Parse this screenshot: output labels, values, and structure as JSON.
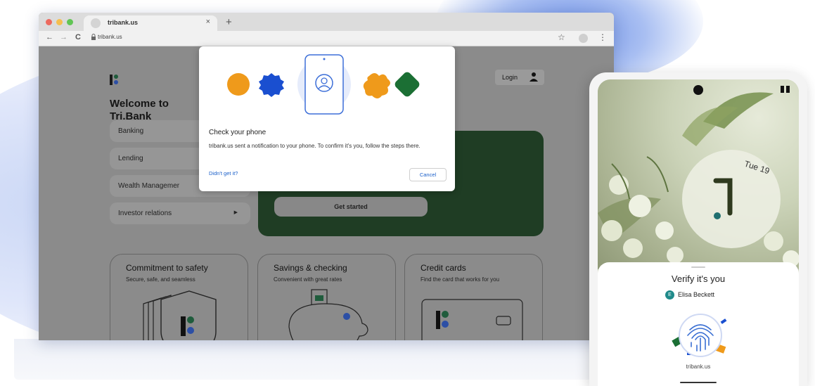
{
  "browser": {
    "tab_title": "tribank.us",
    "tab_close": "×",
    "new_tab": "+",
    "back": "←",
    "forward": "→",
    "reload": "C",
    "url": "tribank.us",
    "bookmark": "☆",
    "more": "⋮"
  },
  "site": {
    "welcome": "Welcome to Tri.Bank",
    "login_label": "Login",
    "nav": [
      {
        "label": "Banking",
        "arrow": ""
      },
      {
        "label": "Lending",
        "arrow": ""
      },
      {
        "label": "Wealth Managemer",
        "arrow": ""
      },
      {
        "label": "Investor relations",
        "arrow": "▶"
      }
    ],
    "hero_button": "Get started",
    "features": [
      {
        "title": "Commitment to safety",
        "subtitle": "Secure, safe, and seamless"
      },
      {
        "title": "Savings & checking",
        "subtitle": "Convenient with great rates"
      },
      {
        "title": "Credit cards",
        "subtitle": "Find the card that works for you"
      }
    ]
  },
  "dialog": {
    "title": "Check your phone",
    "body": "tribank.us sent a notification to your phone. To confirm it's you, follow the steps there.",
    "link": "Didn't get it?",
    "cancel": "Cancel"
  },
  "phone": {
    "date": "Tue 19",
    "sheet_title": "Verify it's you",
    "user_initial": "E",
    "user_name": "Elisa Beckett",
    "origin": "tribank.us"
  },
  "colors": {
    "accent_blue": "#1a5fc9",
    "green_card": "#1f3d24",
    "shape_orange": "#ef9a1b",
    "shape_blue": "#1a4fd0",
    "shape_green": "#1b6f34"
  }
}
